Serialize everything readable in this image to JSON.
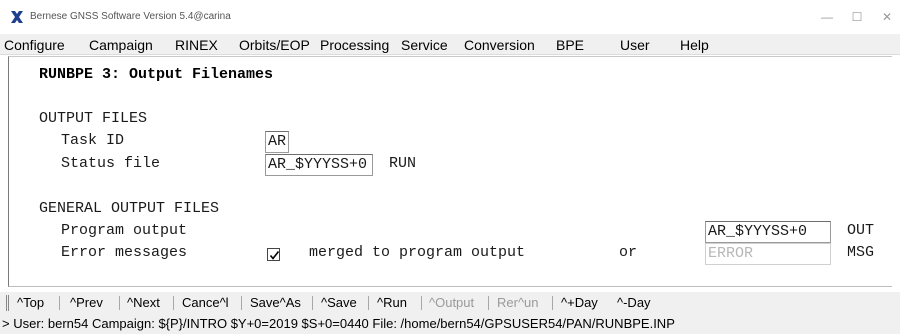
{
  "window": {
    "title": "Bernese GNSS Software Version 5.4@carina",
    "minimize_glyph": "—",
    "maximize_glyph": "☐",
    "close_glyph": "✕"
  },
  "menu": [
    "Configure",
    "Campaign",
    "RINEX",
    "Orbits/EOP",
    "Processing",
    "Service",
    "Conversion",
    "BPE",
    "User",
    "Help"
  ],
  "panel": {
    "title": "RUNBPE 3: Output Filenames",
    "output_files": {
      "heading": "OUTPUT FILES",
      "task_id_label": "Task ID",
      "task_id_value": "AR",
      "status_file_label": "Status file",
      "status_file_value": "AR_$YYYSS+0",
      "status_file_ext": "RUN"
    },
    "general_output_files": {
      "heading": "GENERAL OUTPUT FILES",
      "program_output_label": "Program output",
      "program_output_value": "AR_$YYYSS+0",
      "program_output_ext": "OUT",
      "error_messages_label": "Error messages",
      "merged_checked": true,
      "merged_label": "merged to program output",
      "or_label": "or",
      "error_value": "ERROR",
      "error_ext": "MSG"
    }
  },
  "toolbar": {
    "top": "^Top",
    "prev": "^Prev",
    "next": "^Next",
    "cancel": "Cance^l",
    "save_as": "Save^As",
    "save": "^Save",
    "run": "^Run",
    "output": "^Output",
    "rerun": "Rer^un",
    "plus_day": "^+Day",
    "minus_day": "^-Day"
  },
  "status_line": "> User: bern54  Campaign: ${P}/INTRO  $Y+0=2019  $S+0=0440  File: /home/bern54/GPSUSER54/PAN/RUNBPE.INP"
}
